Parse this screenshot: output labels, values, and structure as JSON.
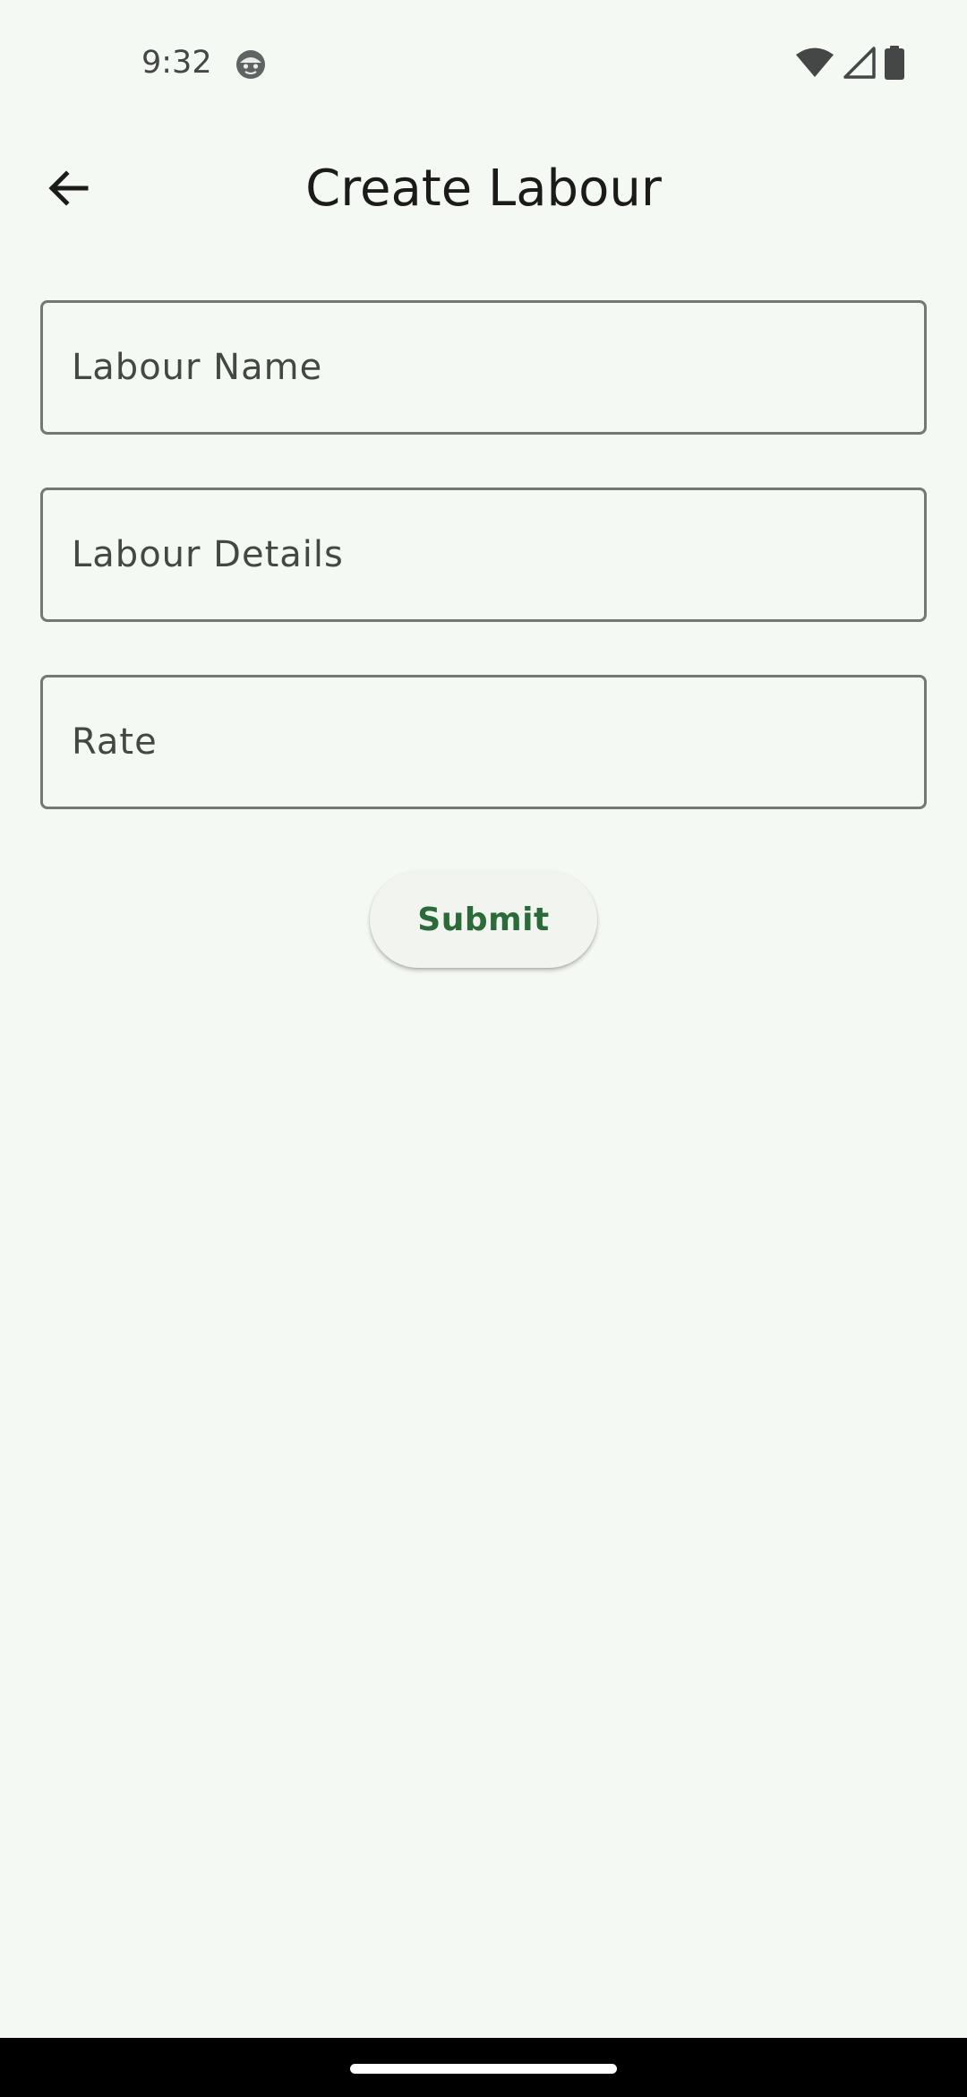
{
  "status_bar": {
    "time": "9:32",
    "left_icons": [
      "face-notification-icon"
    ],
    "right_icons": [
      "wifi-icon",
      "cellular-signal-icon",
      "battery-icon"
    ]
  },
  "app_bar": {
    "back_icon": "arrow-back-icon",
    "title": "Create Labour"
  },
  "form": {
    "fields": [
      {
        "placeholder": "Labour Name",
        "value": ""
      },
      {
        "placeholder": "Labour Details",
        "value": ""
      },
      {
        "placeholder": "Rate",
        "value": ""
      }
    ],
    "submit_label": "Submit"
  },
  "colors": {
    "background": "#f5f9f4",
    "field_border": "#72796f",
    "button_text": "#2b6b3a",
    "button_background": "#f1f4ef",
    "nav_bar": "#000000"
  }
}
